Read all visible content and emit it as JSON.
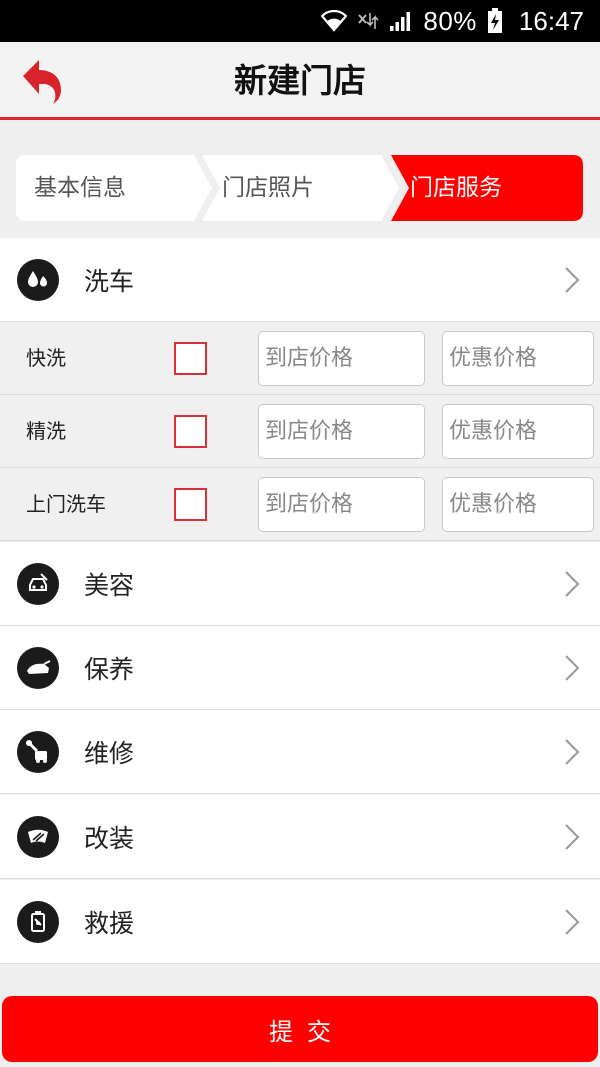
{
  "status_bar": {
    "battery_percent": "80%",
    "time": "16:47"
  },
  "header": {
    "title": "新建门店",
    "back_icon": "back-arrow-icon"
  },
  "steps": [
    {
      "label": "基本信息",
      "active": false
    },
    {
      "label": "门店照片",
      "active": false
    },
    {
      "label": "门店服务",
      "active": true
    }
  ],
  "categories": [
    {
      "label": "洗车",
      "icon": "water-drops-icon",
      "expanded": true
    },
    {
      "label": "美容",
      "icon": "car-beauty-icon"
    },
    {
      "label": "保养",
      "icon": "oil-can-icon"
    },
    {
      "label": "维修",
      "icon": "repair-wrench-icon"
    },
    {
      "label": "改装",
      "icon": "windshield-icon"
    },
    {
      "label": "救援",
      "icon": "fuel-can-icon"
    }
  ],
  "wash_options": [
    {
      "label": "快洗",
      "checked": false,
      "store_price_placeholder": "到店价格",
      "promo_price_placeholder": "优惠价格"
    },
    {
      "label": "精洗",
      "checked": false,
      "store_price_placeholder": "到店价格",
      "promo_price_placeholder": "优惠价格"
    },
    {
      "label": "上门洗车",
      "checked": false,
      "store_price_placeholder": "到店价格",
      "promo_price_placeholder": "优惠价格"
    }
  ],
  "submit_label": "提交",
  "colors": {
    "accent": "#fe0000",
    "header_line": "#e0262b",
    "checkbox_border": "#d9303a"
  }
}
